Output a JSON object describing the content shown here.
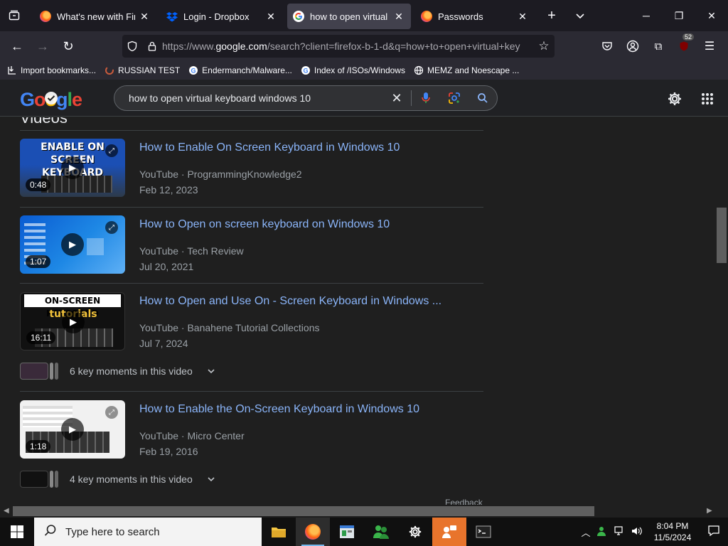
{
  "browser": {
    "tabs": [
      {
        "title": "What's new with Firefo",
        "favicon": "firefox-icon",
        "active": false
      },
      {
        "title": "Login - Dropbox",
        "favicon": "dropbox-icon",
        "active": false
      },
      {
        "title": "how to open virtual ke",
        "favicon": "google-icon",
        "active": true
      },
      {
        "title": "Passwords",
        "favicon": "firefox-icon",
        "active": false
      }
    ],
    "url": {
      "prefix": "https://www.",
      "domain": "google.com",
      "rest": "/search?client=firefox-b-1-d&q=how+to+open+virtual+key"
    },
    "extension_badge": "52",
    "bookmarks": [
      {
        "label": "Import bookmarks...",
        "icon": "import-icon"
      },
      {
        "label": "RUSSIAN TEST",
        "icon": "spinner-icon"
      },
      {
        "label": "Endermanch/Malware...",
        "icon": "google-icon"
      },
      {
        "label": "Index of /ISOs/Windows",
        "icon": "google-icon"
      },
      {
        "label": "MEMZ and Noescape ...",
        "icon": "globe-icon"
      }
    ]
  },
  "google": {
    "logo": "Google",
    "query": "how to open virtual keyboard windows 10"
  },
  "results": {
    "heading": "Videos",
    "videos": [
      {
        "title": "How to Enable On Screen Keyboard in Windows 10",
        "source": "YouTube",
        "channel": "ProgrammingKnowledge2",
        "date": "Feb 12, 2023",
        "duration": "0:48",
        "thumb_text": "ENABLE ON SCREEN KEYBOARD"
      },
      {
        "title": "How to Open on screen keyboard on Windows 10",
        "source": "YouTube",
        "channel": "Tech Review",
        "date": "Jul 20, 2021",
        "duration": "1:07"
      },
      {
        "title": "How to Open and Use On - Screen Keyboard in Windows ...",
        "source": "YouTube",
        "channel": "Banahene Tutorial Collections",
        "date": "Jul 7, 2024",
        "duration": "16:11",
        "thumb_text": "ON-SCREEN KEYBOARD",
        "thumb_sub": "tutorials",
        "key_moments": "6 key moments in this video"
      },
      {
        "title": "How to Enable the On-Screen Keyboard in Windows 10",
        "source": "YouTube",
        "channel": "Micro Center",
        "date": "Feb 19, 2016",
        "duration": "1:18",
        "key_moments": "4 key moments in this video"
      }
    ],
    "meta_separator": " · ",
    "feedback": "Feedback"
  },
  "taskbar": {
    "search_placeholder": "Type here to search",
    "time": "8:04 PM",
    "date": "11/5/2024"
  }
}
